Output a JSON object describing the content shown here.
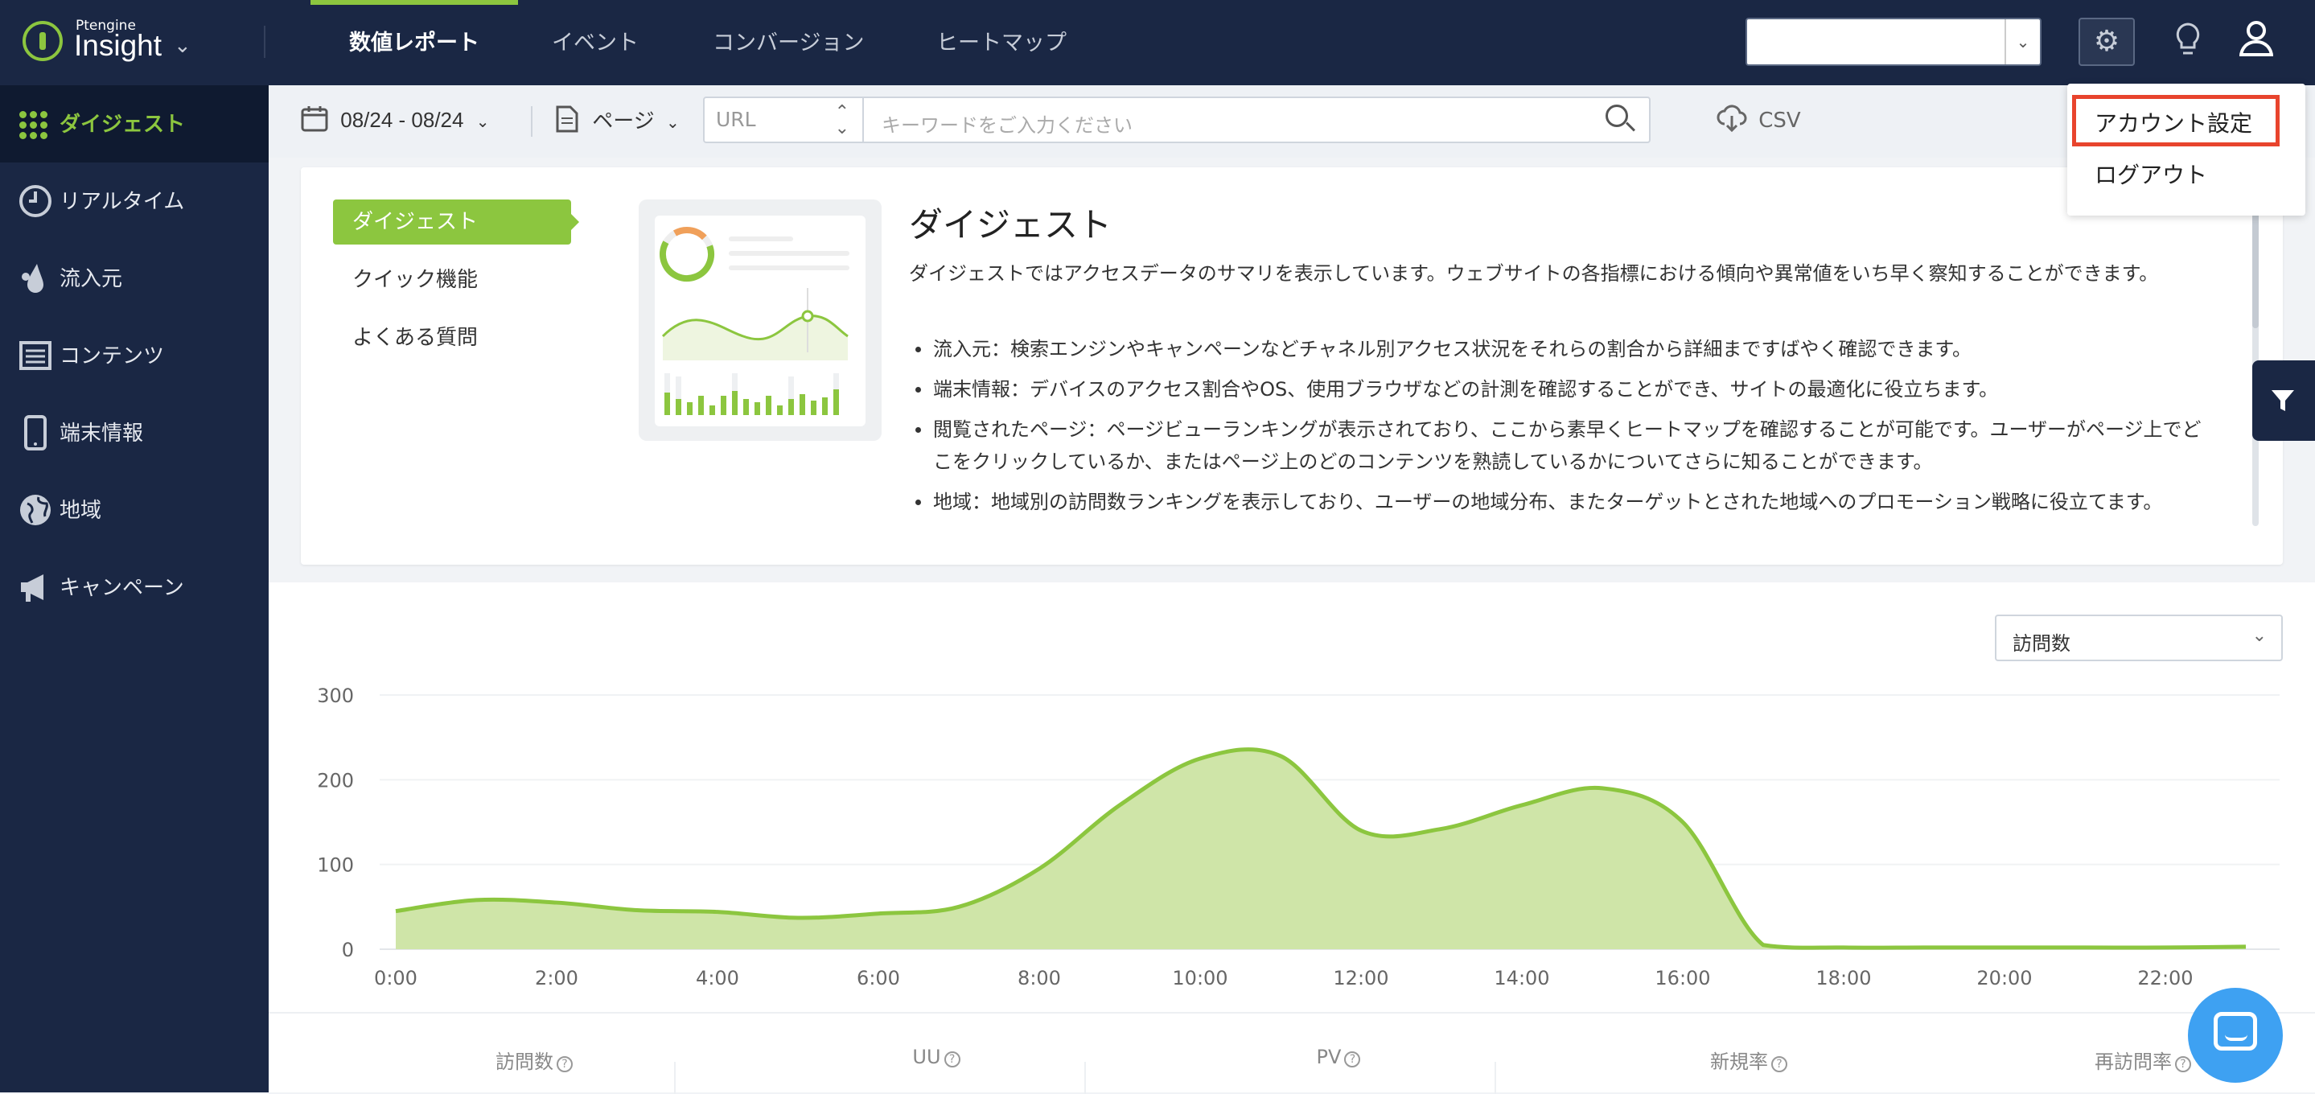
{
  "app": {
    "brand_small": "Ptengine",
    "brand": "Insight"
  },
  "top_nav": {
    "tabs": [
      {
        "label": "数値レポート",
        "active": true
      },
      {
        "label": "イベント",
        "active": false
      },
      {
        "label": "コンバージョン",
        "active": false
      },
      {
        "label": "ヒートマップ",
        "active": false
      }
    ],
    "site_select_value": ""
  },
  "sidebar": {
    "items": [
      {
        "label": "ダイジェスト",
        "icon": "grid-dots-icon",
        "active": true
      },
      {
        "label": "リアルタイム",
        "icon": "clock-icon",
        "active": false
      },
      {
        "label": "流入元",
        "icon": "drop-icon",
        "active": false
      },
      {
        "label": "コンテンツ",
        "icon": "content-icon",
        "active": false
      },
      {
        "label": "端末情報",
        "icon": "mobile-icon",
        "active": false
      },
      {
        "label": "地域",
        "icon": "globe-icon",
        "active": false
      },
      {
        "label": "キャンペーン",
        "icon": "megaphone-icon",
        "active": false
      }
    ]
  },
  "filter_bar": {
    "date_range": "08/24 - 08/24",
    "page_label": "ページ",
    "url_type": "URL",
    "keyword_placeholder": "キーワードをご入力ください",
    "csv_label": "CSV"
  },
  "info_card": {
    "tabs": [
      {
        "label": "ダイジェスト",
        "active": true
      },
      {
        "label": "クイック機能",
        "active": false
      },
      {
        "label": "よくある質問",
        "active": false
      }
    ],
    "title": "ダイジェスト",
    "description": "ダイジェストではアクセスデータのサマリを表示しています。ウェブサイトの各指標における傾向や異常値をいち早く察知することができます。",
    "bullets": [
      "流入元：検索エンジンやキャンペーンなどチャネル別アクセス状況をそれらの割合から詳細まですばやく確認できます。",
      "端末情報：デバイスのアクセス割合やOS、使用ブラウザなどの計測を確認することができ、サイトの最適化に役立ちます。",
      "閲覧されたページ：ページビューランキングが表示されており、ここから素早くヒートマップを確認することが可能です。ユーザーがページ上でどこをクリックしているか、またはページ上のどのコンテンツを熟読しているかについてさらに知ることができます。",
      "地域：地域別の訪問数ランキングを表示しており、ユーザーの地域分布、またターゲットとされた地域へのプロモーション戦略に役立てます。"
    ]
  },
  "metric_select": {
    "value": "訪問数"
  },
  "account_menu": {
    "items": [
      "アカウント設定",
      "ログアウト"
    ]
  },
  "stats": {
    "labels": [
      "訪問数",
      "UU",
      "PV",
      "新規率",
      "再訪問率"
    ]
  },
  "colors": {
    "nav_bg": "#1a2744",
    "accent": "#8cc63f",
    "fill": "#cfe5a8",
    "highlight": "#e8442d"
  },
  "chart_data": {
    "type": "area",
    "x": [
      "0:00",
      "1:00",
      "2:00",
      "3:00",
      "4:00",
      "5:00",
      "6:00",
      "7:00",
      "8:00",
      "9:00",
      "10:00",
      "11:00",
      "12:00",
      "13:00",
      "14:00",
      "15:00",
      "16:00",
      "17:00",
      "18:00",
      "19:00",
      "20:00",
      "21:00",
      "22:00",
      "23:00"
    ],
    "x_tick_labels": [
      "0:00",
      "2:00",
      "4:00",
      "6:00",
      "8:00",
      "10:00",
      "12:00",
      "14:00",
      "16:00",
      "18:00",
      "20:00",
      "22:00"
    ],
    "series": [
      {
        "values": [
          45,
          58,
          55,
          46,
          44,
          37,
          42,
          50,
          95,
          170,
          225,
          228,
          140,
          142,
          170,
          190,
          150,
          5,
          2,
          2,
          2,
          2,
          2,
          3
        ]
      }
    ],
    "ylim": [
      0,
      300
    ],
    "y_ticks": [
      0,
      100,
      200,
      300
    ],
    "grid": true
  }
}
